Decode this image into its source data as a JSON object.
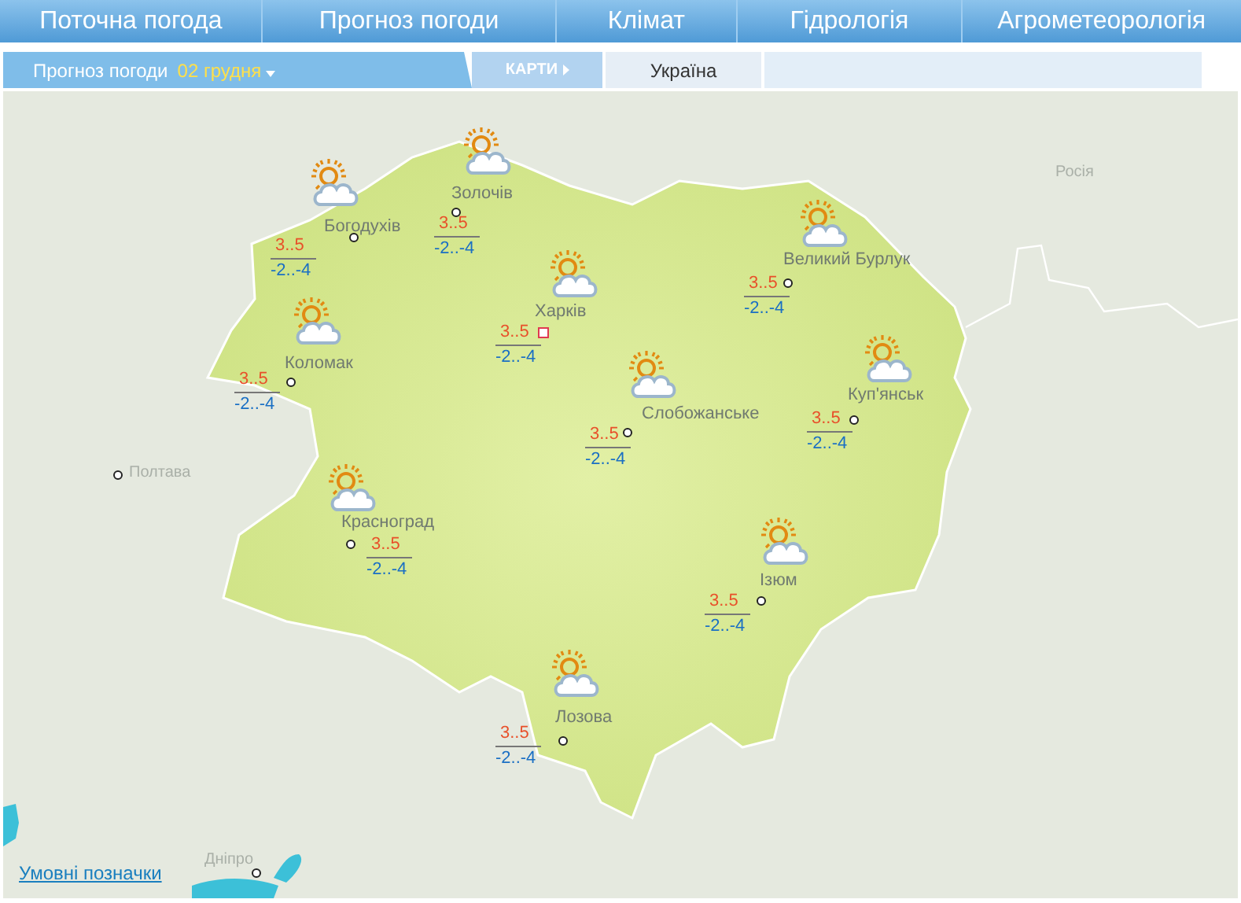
{
  "nav": [
    {
      "label": "Поточна погода"
    },
    {
      "label": "Прогноз погоди"
    },
    {
      "label": "Клімат"
    },
    {
      "label": "Гідрологія"
    },
    {
      "label": "Агрометеорологія"
    }
  ],
  "subbar": {
    "title": "Прогноз погоди",
    "date": "02 грудня",
    "maps_button": "КАРТИ",
    "region": "Україна"
  },
  "map": {
    "cities": [
      {
        "name": "Богодухів",
        "kind": "town",
        "day": "3..5",
        "night": "-2..-4"
      },
      {
        "name": "Золочів",
        "kind": "town",
        "day": "3..5",
        "night": "-2..-4"
      },
      {
        "name": "Харків",
        "kind": "capital",
        "day": "3..5",
        "night": "-2..-4"
      },
      {
        "name": "Коломак",
        "kind": "town",
        "day": "3..5",
        "night": "-2..-4"
      },
      {
        "name": "Великий Бурлук",
        "kind": "town",
        "day": "3..5",
        "night": "-2..-4"
      },
      {
        "name": "Слобожанське",
        "kind": "town",
        "day": "3..5",
        "night": "-2..-4"
      },
      {
        "name": "Куп'янськ",
        "kind": "town",
        "day": "3..5",
        "night": "-2..-4"
      },
      {
        "name": "Красноград",
        "kind": "town",
        "day": "3..5",
        "night": "-2..-4"
      },
      {
        "name": "Ізюм",
        "kind": "town",
        "day": "3..5",
        "night": "-2..-4"
      },
      {
        "name": "Лозова",
        "kind": "town",
        "day": "3..5",
        "night": "-2..-4"
      }
    ],
    "neighbors": [
      {
        "name": "Полтава",
        "kind": "city"
      },
      {
        "name": "Росія",
        "kind": "country"
      },
      {
        "name": "Дніпро",
        "kind": "city"
      }
    ],
    "legend_link": "Умовні позначки"
  }
}
